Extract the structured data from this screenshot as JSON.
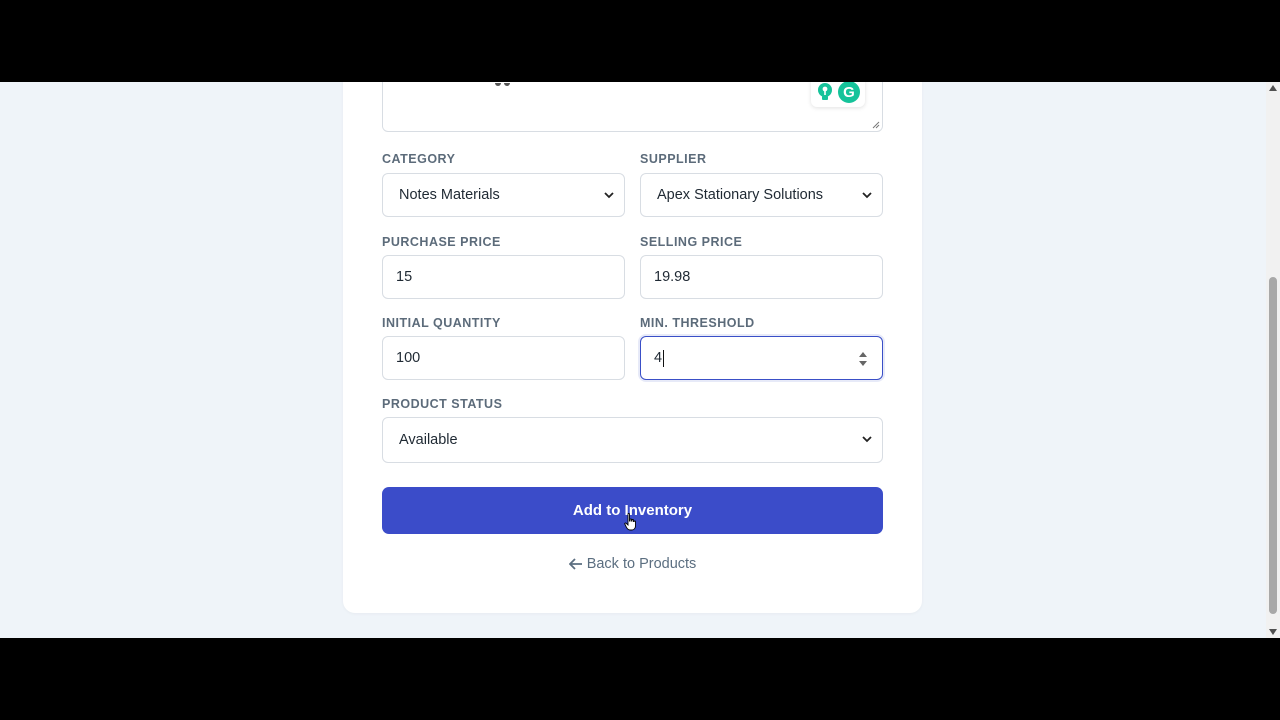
{
  "form": {
    "category": {
      "label": "CATEGORY",
      "value": "Notes Materials"
    },
    "supplier": {
      "label": "SUPPLIER",
      "value": "Apex Stationary Solutions"
    },
    "purchase_price": {
      "label": "PURCHASE PRICE",
      "value": "15"
    },
    "selling_price": {
      "label": "SELLING PRICE",
      "value": "19.98"
    },
    "initial_quantity": {
      "label": "INITIAL QUANTITY",
      "value": "100"
    },
    "min_threshold": {
      "label": "MIN. THRESHOLD",
      "value": "4"
    },
    "product_status": {
      "label": "PRODUCT STATUS",
      "value": "Available"
    },
    "submit_label": "Add to Inventory",
    "back_label": "Back to Products",
    "grammarly_letter": "G"
  },
  "colors": {
    "primary": "#3b4cc9",
    "page_bg": "#eff4f9",
    "label": "#5c6b7a",
    "grammarly": "#15c39a"
  },
  "icons": {
    "select_arrow": "chevron-down-icon",
    "back": "arrow-left-icon",
    "spinner": "number-spinner-icon",
    "grammarly": "grammarly-icon",
    "suggestion": "lightbulb-icon"
  }
}
